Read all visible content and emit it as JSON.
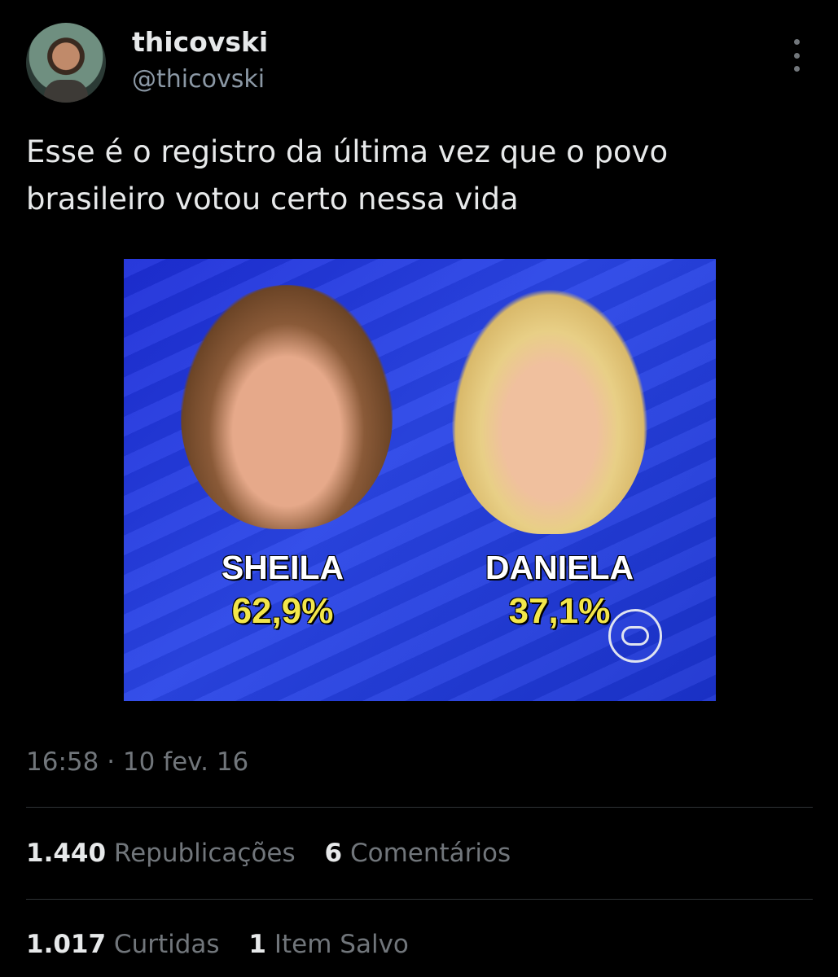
{
  "author": {
    "display_name": "thicovski",
    "handle": "@thicovski"
  },
  "tweet": {
    "text": "Esse é o registro da última vez que o povo brasileiro votou certo nessa vida",
    "timestamp": "16:58 · 10 fev. 16"
  },
  "media": {
    "candidates": [
      {
        "name": "SHEILA",
        "percent": "62,9%"
      },
      {
        "name": "DANIELA",
        "percent": "37,1%"
      }
    ],
    "logo_icon": "globo-icon"
  },
  "stats": {
    "reposts_count": "1.440",
    "reposts_label": "Republicações",
    "comments_count": "6",
    "comments_label": "Comentários",
    "likes_count": "1.017",
    "likes_label": "Curtidas",
    "saves_count": "1",
    "saves_label": "Item Salvo"
  },
  "colors": {
    "background": "#000000",
    "text_primary": "#e7e9ea",
    "text_secondary": "#71767b",
    "media_blue": "#2a46e8",
    "percent_yellow": "#f3e64a"
  }
}
